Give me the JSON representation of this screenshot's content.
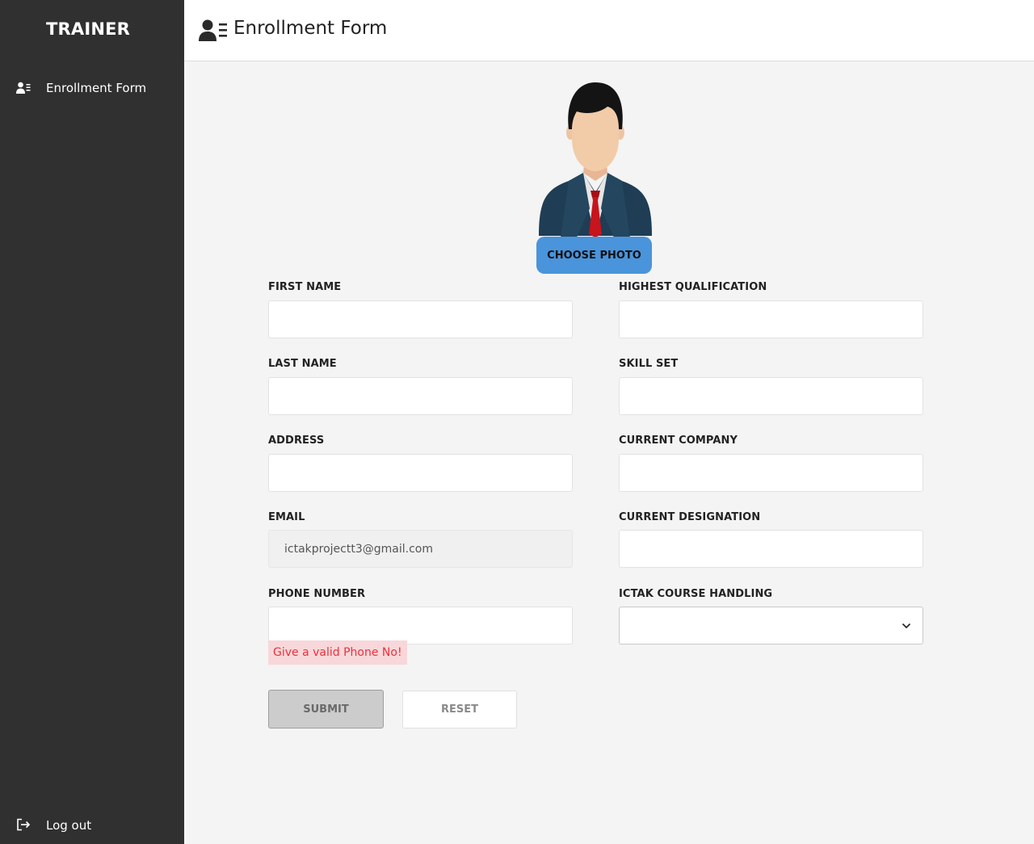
{
  "sidebar": {
    "brand": "TRAINER",
    "nav_items": [
      {
        "label": "Enrollment Form",
        "icon": "user-list-icon"
      }
    ],
    "logout": {
      "label": "Log out",
      "icon": "logout-icon"
    }
  },
  "header": {
    "title": "Enrollment Form",
    "icon": "user-list-icon"
  },
  "photo": {
    "button_label": "CHOOSE PHOTO"
  },
  "form": {
    "first_name": {
      "label": "FIRST NAME",
      "value": ""
    },
    "last_name": {
      "label": "LAST NAME",
      "value": ""
    },
    "address": {
      "label": "ADDRESS",
      "value": ""
    },
    "email": {
      "label": "EMAIL",
      "value": "ictakprojectt3@gmail.com"
    },
    "phone_number": {
      "label": "PHONE NUMBER",
      "value": "",
      "error": "Give a valid Phone No!"
    },
    "highest_qualification": {
      "label": "HIGHEST QUALIFICATION",
      "value": ""
    },
    "skill_set": {
      "label": "SKILL SET",
      "value": ""
    },
    "current_company": {
      "label": "CURRENT COMPANY",
      "value": ""
    },
    "current_designation": {
      "label": "CURRENT DESIGNATION",
      "value": ""
    },
    "ictak_course_handling": {
      "label": "ICTAK COURSE HANDLING",
      "value": ""
    },
    "submit_label": "SUBMIT",
    "reset_label": "RESET"
  },
  "colors": {
    "sidebar_bg": "#303030",
    "accent_button": "#4a94db",
    "error_bg": "#f8d7da",
    "error_text": "#e8323c"
  }
}
